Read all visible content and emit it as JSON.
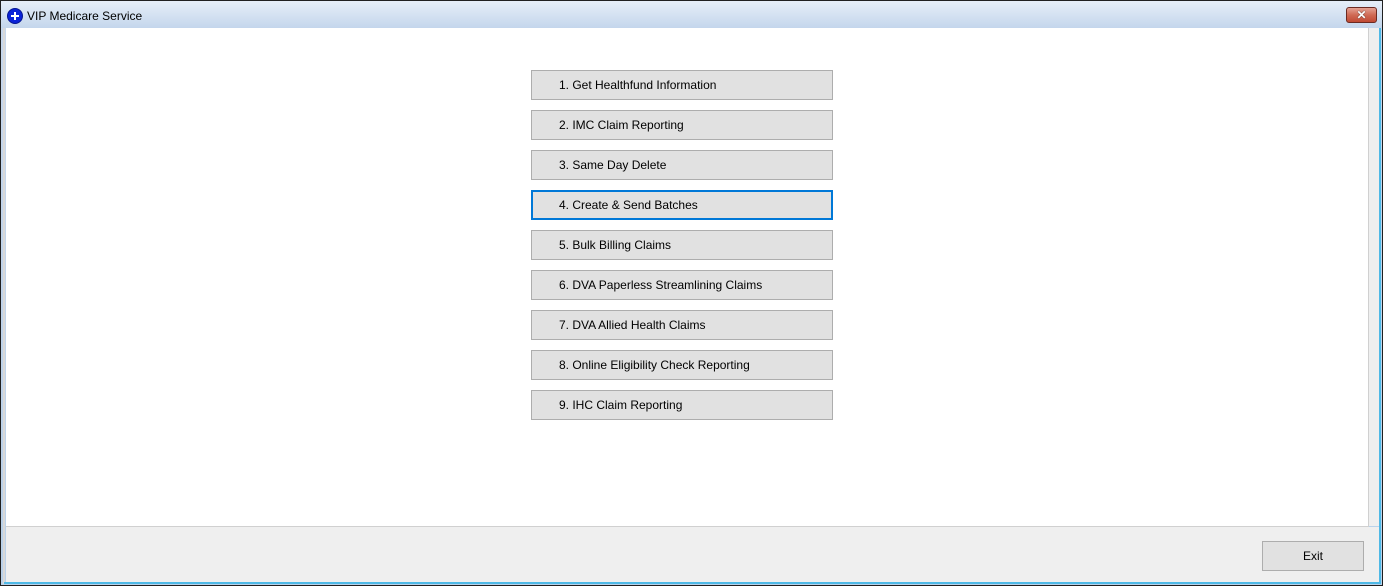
{
  "window": {
    "title": "VIP Medicare Service",
    "app_icon": "blue-plus-circle-icon",
    "close_icon": "close-icon",
    "close_glyph": "✕"
  },
  "menu": {
    "focused_index": 3,
    "items": [
      {
        "label": "1. Get Healthfund Information"
      },
      {
        "label": "2. IMC Claim Reporting"
      },
      {
        "label": "3. Same Day Delete"
      },
      {
        "label": "4. Create & Send Batches"
      },
      {
        "label": "5. Bulk Billing Claims"
      },
      {
        "label": "6. DVA Paperless Streamlining Claims"
      },
      {
        "label": "7. DVA Allied Health Claims"
      },
      {
        "label": "8. Online Eligibility Check Reporting"
      },
      {
        "label": "9. IHC Claim Reporting"
      }
    ]
  },
  "footer": {
    "exit_label": "Exit"
  },
  "colors": {
    "focus_border": "#0078d7",
    "button_face": "#e1e1e1",
    "button_border": "#adadad"
  }
}
